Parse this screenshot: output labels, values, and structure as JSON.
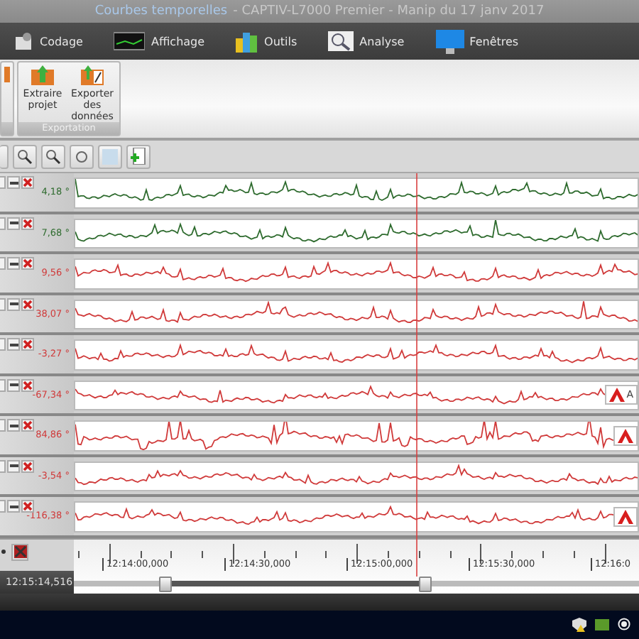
{
  "window": {
    "title_view": "Courbes temporelles",
    "title_rest": "- CAPTIV-L7000 Premier - Manip du 17 janv 2017"
  },
  "menu": [
    {
      "label": "Codage",
      "kind": "codage"
    },
    {
      "label": "Affichage",
      "kind": "affichage"
    },
    {
      "label": "Outils",
      "kind": "outils"
    },
    {
      "label": "Analyse",
      "kind": "analyse"
    },
    {
      "label": "Fenêtres",
      "kind": "fenetres"
    }
  ],
  "ribbon": {
    "group": "Exportation",
    "buttons": [
      {
        "label": "Extraire projet",
        "kind": "extract"
      },
      {
        "label": "Exporter des données",
        "kind": "export"
      }
    ]
  },
  "channels": [
    {
      "reading": "4,18 °",
      "color": "#2e6b2e"
    },
    {
      "reading": "7,68 °",
      "color": "#2e6b2e"
    },
    {
      "reading": "9,56 °",
      "color": "#d03a3a"
    },
    {
      "reading": "38,07 °",
      "color": "#d03a3a"
    },
    {
      "reading": "-3,27 °",
      "color": "#d03a3a"
    },
    {
      "reading": "-67,34 °",
      "color": "#d03a3a",
      "marker": true,
      "marker_label": "A"
    },
    {
      "reading": "84,86 °",
      "color": "#d03a3a",
      "marker": true
    },
    {
      "reading": "-3,54 °",
      "color": "#d03a3a"
    },
    {
      "reading": "-116,38 °",
      "color": "#d03a3a",
      "marker": true
    }
  ],
  "timeline": {
    "current": "12:15:14,516",
    "ticks": [
      "12:14:00,000",
      "12:14:30,000",
      "12:15:00,000",
      "12:15:30,000",
      "12:16:0"
    ],
    "range_start": {
      "level": 0.16
    },
    "range_end": {
      "level": 0.62
    }
  }
}
